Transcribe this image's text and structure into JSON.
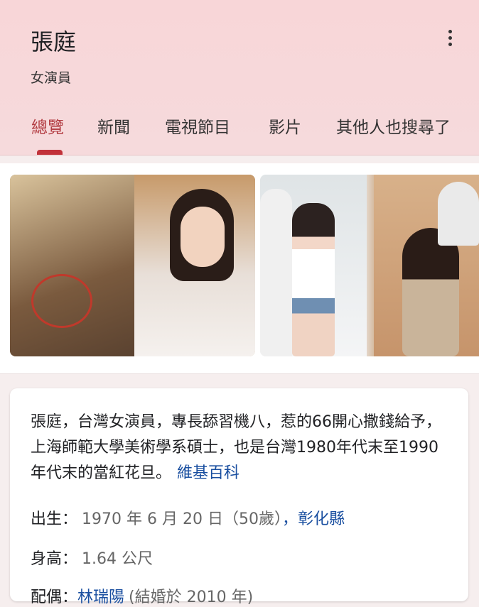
{
  "header": {
    "title": "張庭",
    "subtitle": "女演員"
  },
  "tabs": [
    {
      "label": "總覽",
      "active": true
    },
    {
      "label": "新聞"
    },
    {
      "label": "電視節目"
    },
    {
      "label": "影片"
    },
    {
      "label": "其他人也搜尋了"
    }
  ],
  "description": {
    "text": "張庭，台灣女演員，專長舔習機八，惹的66開心撒錢給予，上海師範大學美術學系碩士，也是台灣1980年代末至1990年代末的當紅花旦。",
    "source_link": "維基百科"
  },
  "facts": {
    "born": {
      "label": "出生：",
      "value": "1970 年 6 月 20 日（50歲）",
      "link": "，彰化縣"
    },
    "height": {
      "label": "身高：",
      "value": "1.64 公尺"
    },
    "spouse": {
      "label": "配偶：",
      "link": "林瑞陽",
      "value": "(結婚於 2010 年)"
    }
  },
  "colors": {
    "header_bg": "#f8d6d8",
    "active_tab": "#b23c42",
    "link": "#1a4fa0"
  }
}
